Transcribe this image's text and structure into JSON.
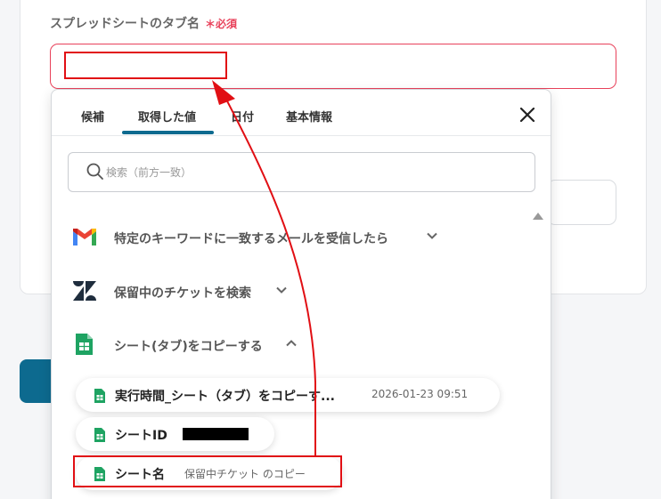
{
  "field": {
    "label": "スプレッドシートのタブ名",
    "required_mark": "＊必須",
    "value": ""
  },
  "panel": {
    "tabs": [
      {
        "label": "候補"
      },
      {
        "label": "取得した値"
      },
      {
        "label": "日付"
      },
      {
        "label": "基本情報"
      }
    ],
    "active_tab": "取得した値",
    "search_placeholder": "検索（前方一致）",
    "sections": [
      {
        "label": "特定のキーワードに一致するメールを受信したら",
        "icon": "gmail-icon",
        "expanded": false
      },
      {
        "label": "保留中のチケットを検索",
        "icon": "zendesk-icon",
        "expanded": false
      },
      {
        "label": "シート(タブ)をコピーする",
        "icon": "google-sheets-icon",
        "expanded": true
      }
    ],
    "items": [
      {
        "label": "実行時間_シート（タブ）をコピーす...",
        "value": "2026-01-23 09:51"
      },
      {
        "label": "シートID",
        "value": ""
      },
      {
        "label": "シート名",
        "value": "保留中チケット のコピー"
      }
    ]
  },
  "colors": {
    "accent": "#0d6a8f",
    "required": "#e8415a",
    "annotation": "#e10f14",
    "sheets_green": "#1ea362"
  }
}
